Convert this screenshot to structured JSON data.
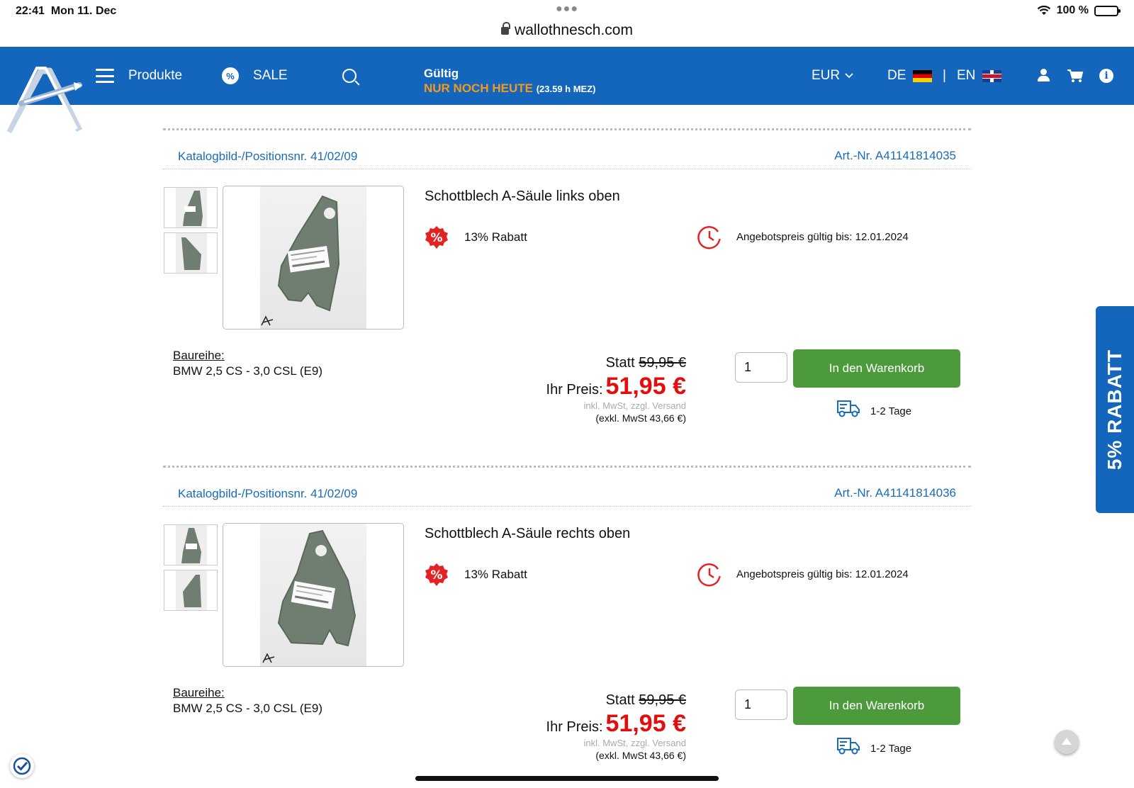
{
  "status_bar": {
    "time": "22:41",
    "date": "Mon 11. Dec",
    "url": "wallothnesch.com",
    "battery": "100 %"
  },
  "header": {
    "menu_label": "Produkte",
    "sale_label": "SALE",
    "sale_icon_text": "%",
    "valid_line1": "Gültig",
    "valid_line2": "NUR NOCH HEUTE",
    "valid_time": "(23.59 h MEZ)",
    "currency": "EUR",
    "lang_de": "DE",
    "lang_sep": "|",
    "lang_en": "EN",
    "info_icon_text": "i"
  },
  "colors": {
    "brand_blue": "#1466bd",
    "price_red": "#e40d0d",
    "cart_green": "#4d9a3c",
    "link_blue": "#1a6cb8",
    "highlight_orange": "#f39a1e"
  },
  "products": [
    {
      "katalog": "Katalogbild-/Positionsnr. 41/02/09",
      "artnr": "Art.-Nr. A41141814035",
      "title": "Schottblech A-Säule links oben",
      "rabatt": "13% Rabatt",
      "angebot": "Angebotspreis gültig bis: 12.01.2024",
      "baureihe_label": "Baureihe:",
      "baureihe_value": "BMW 2,5 CS - 3,0 CSL (E9)",
      "statt_label": "Statt",
      "old_price": "59,95 €",
      "ihr_label": "Ihr Preis:",
      "price": "51,95 €",
      "inkl": "inkl. MwSt, zzgl. Versand",
      "exkl": "(exkl. MwSt 43,66 €)",
      "qty": "1",
      "cart_label": "In den Warenkorb",
      "delivery": "1-2 Tage"
    },
    {
      "katalog": "Katalogbild-/Positionsnr. 41/02/09",
      "artnr": "Art.-Nr. A41141814036",
      "title": "Schottblech A-Säule rechts oben",
      "rabatt": "13% Rabatt",
      "angebot": "Angebotspreis gültig bis: 12.01.2024",
      "baureihe_label": "Baureihe:",
      "baureihe_value": "BMW 2,5 CS - 3,0 CSL (E9)",
      "statt_label": "Statt",
      "old_price": "59,95 €",
      "ihr_label": "Ihr Preis:",
      "price": "51,95 €",
      "inkl": "inkl. MwSt, zzgl. Versand",
      "exkl": "(exkl. MwSt 43,66 €)",
      "qty": "1",
      "cart_label": "In den Warenkorb",
      "delivery": "1-2 Tage"
    }
  ],
  "side_badge": "5% RABATT"
}
